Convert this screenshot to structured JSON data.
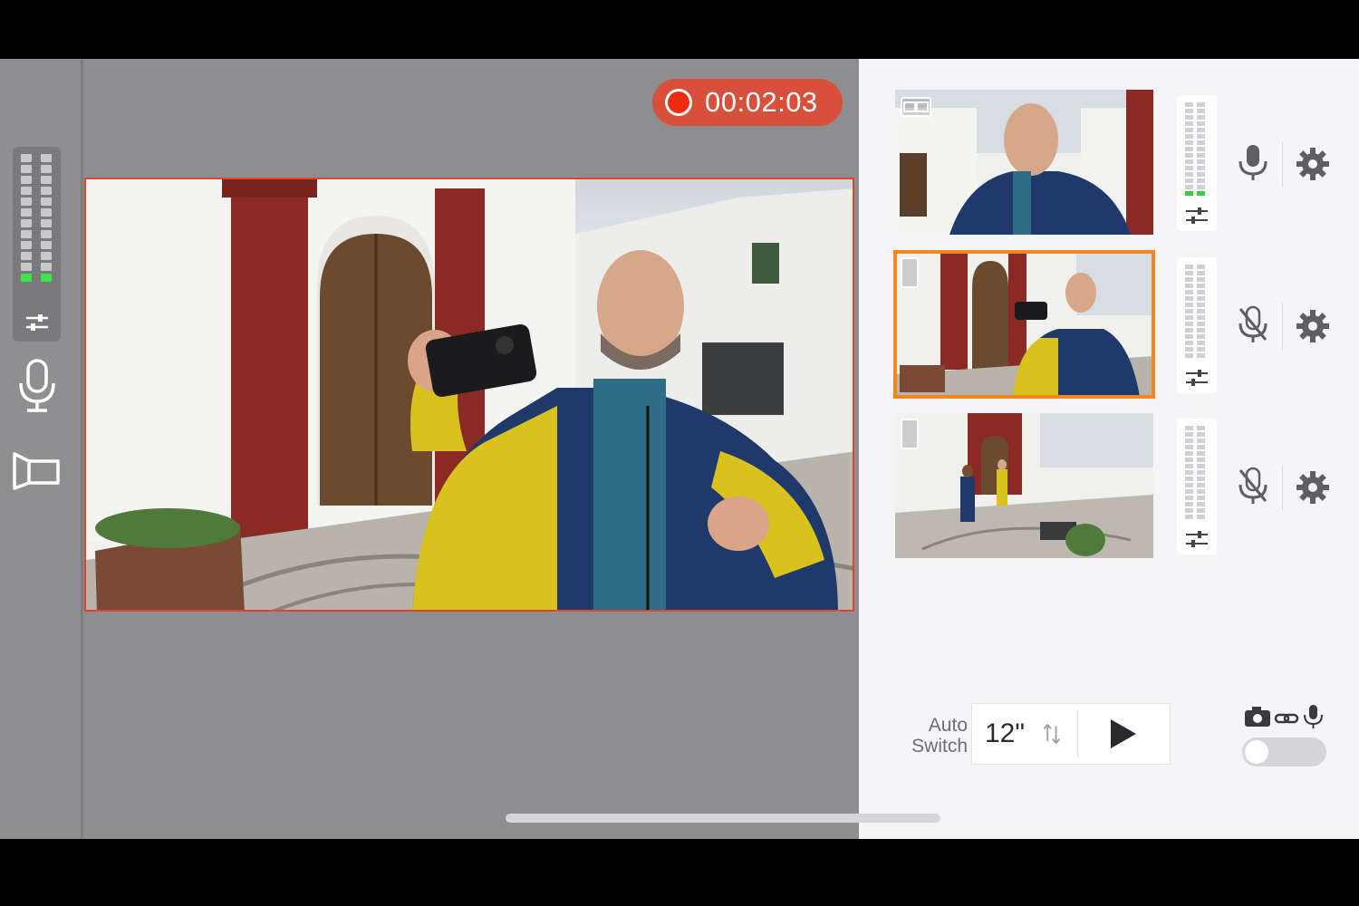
{
  "recording": {
    "timer": "00:02:03",
    "color": "#d9503a"
  },
  "left_rail": {
    "mic_icon": "microphone-icon",
    "view_icon": "camera-view-icon",
    "sliders_icon": "sliders-icon"
  },
  "sources": [
    {
      "name": "camera-source-1",
      "badge_icon": "split-screen-icon",
      "muted": false,
      "selected": false,
      "meter_active": true
    },
    {
      "name": "camera-source-2",
      "badge_icon": "iphone-icon",
      "muted": true,
      "selected": true,
      "meter_active": false
    },
    {
      "name": "camera-source-3",
      "badge_icon": "iphone-icon",
      "muted": true,
      "selected": false,
      "meter_active": false
    }
  ],
  "auto_switch": {
    "label_line1": "Auto",
    "label_line2": "Switch",
    "interval": "12\"",
    "swap_icon": "swap-arrows-icon",
    "play_icon": "play-icon"
  },
  "link_toggle": {
    "icons": [
      "camera-icon",
      "link-icon",
      "microphone-icon"
    ],
    "on": false
  },
  "colors": {
    "accent_selected": "#f2861f",
    "record_red": "#ee2a10",
    "meter_green": "#3ee24a"
  }
}
